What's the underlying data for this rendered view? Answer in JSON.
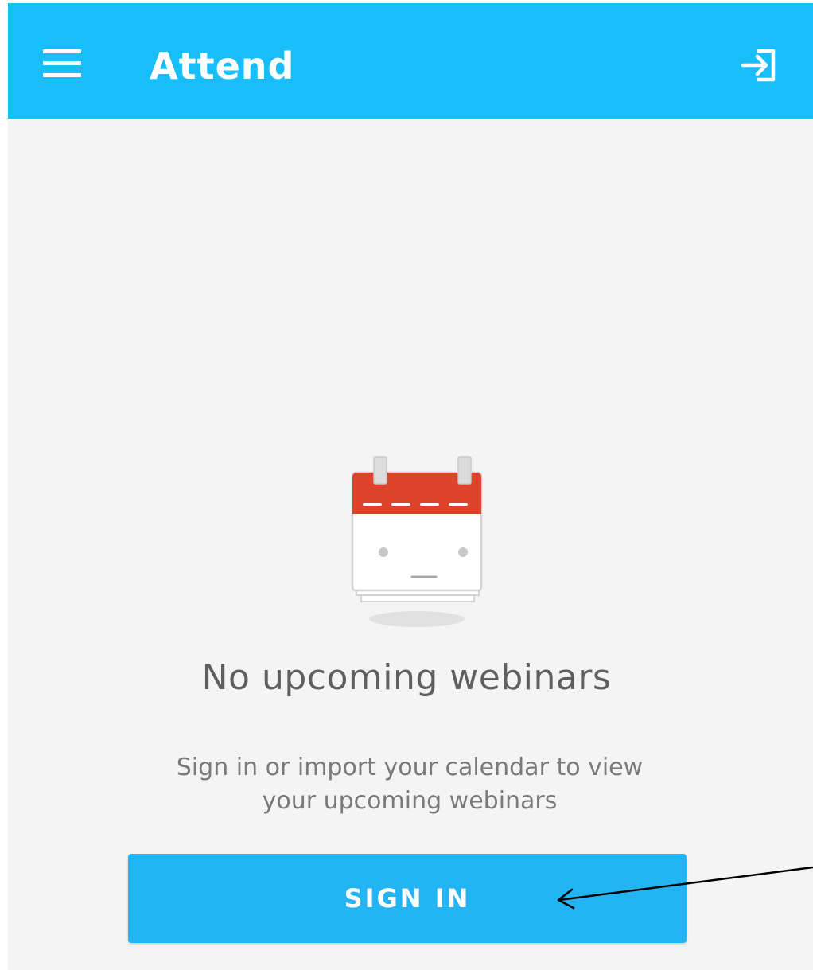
{
  "appbar": {
    "title": "Attend",
    "menu_icon": "hamburger-menu-icon",
    "login_icon": "login-icon",
    "color": "#19bdf8"
  },
  "empty_state": {
    "illustration": "calendar-face-icon",
    "title": "No upcoming webinars",
    "message": "Sign in or import your calendar to view your upcoming webinars"
  },
  "actions": {
    "sign_in_label": "SIGN IN",
    "button_color": "#22b4f3"
  },
  "colors": {
    "background": "#f4f4f4",
    "calendar_header": "#dc4328",
    "annotation": "#000000"
  }
}
